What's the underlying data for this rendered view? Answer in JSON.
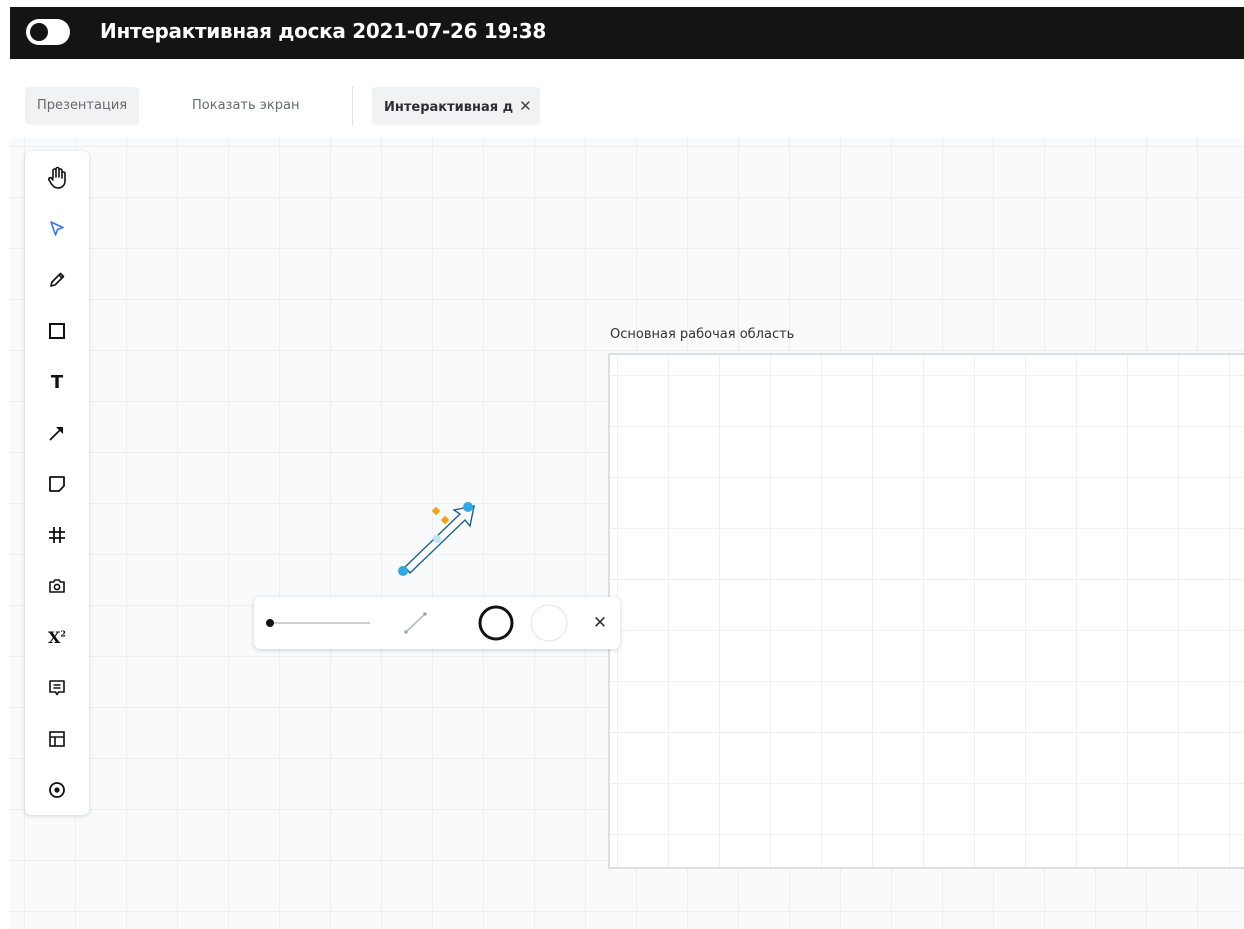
{
  "window": {
    "title": "Интерактивная доска 2021-07-26 19:38"
  },
  "tabs": [
    {
      "label": "Презентация"
    },
    {
      "label": "Показать экран"
    },
    {
      "label": "Интерактивная д",
      "close": "✕"
    }
  ],
  "toolbar": {
    "tools": [
      {
        "name": "hand-icon"
      },
      {
        "name": "select-pointer-icon",
        "active": true,
        "color": "#3b78e7"
      },
      {
        "name": "pencil-icon"
      },
      {
        "name": "rectangle-icon"
      },
      {
        "name": "text-icon",
        "glyph": "T"
      },
      {
        "name": "arrow-icon"
      },
      {
        "name": "sticky-note-icon"
      },
      {
        "name": "frame-grid-icon"
      },
      {
        "name": "camera-icon"
      },
      {
        "name": "formula-icon",
        "glyph": "X",
        "sup": "2"
      },
      {
        "name": "comment-icon"
      },
      {
        "name": "layout-template-icon"
      },
      {
        "name": "laser-pointer-icon"
      }
    ]
  },
  "canvas": {
    "frame_label": "Основная рабочая область",
    "selection_color": "#2ea9e6",
    "handle_color": "#f5a00b"
  },
  "style_popup": {
    "close": "✕"
  }
}
